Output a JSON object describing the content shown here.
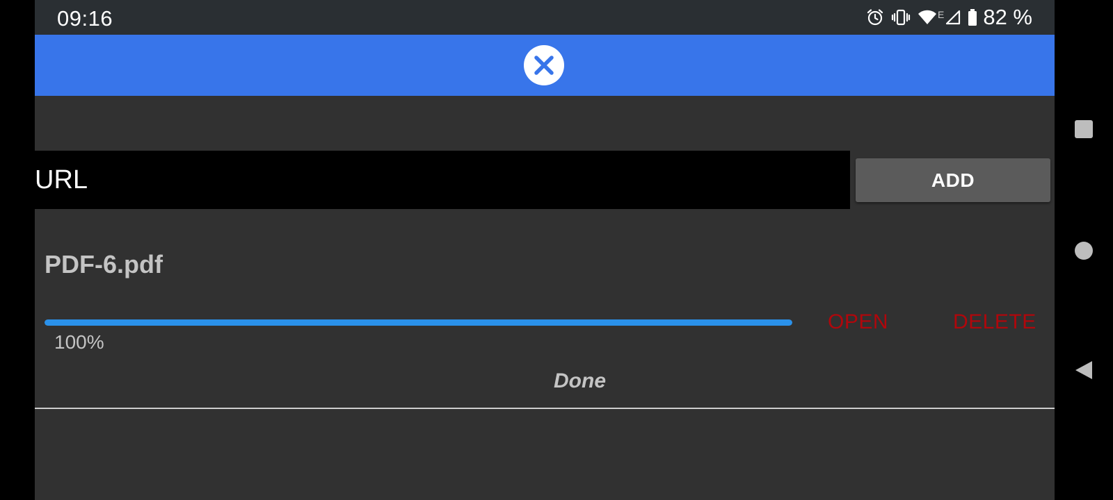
{
  "status_bar": {
    "time": "09:16",
    "battery_percent": "82 %",
    "network_type": "E",
    "icons": [
      "alarm-icon",
      "vibrate-icon",
      "wifi-icon",
      "signal-icon",
      "battery-icon"
    ]
  },
  "header": {
    "close_icon": "close-icon",
    "accent_color": "#3875ea"
  },
  "url_row": {
    "url_placeholder": "URL",
    "add_label": "ADD"
  },
  "downloads": [
    {
      "file_name": "PDF-6.pdf",
      "progress": 1.0,
      "progress_text": "100%",
      "open_label": "OPEN",
      "delete_label": "DELETE",
      "status": "Done",
      "progress_color": "#2a91ea",
      "action_color": "#b0070c"
    }
  ],
  "nav_bar": {
    "icons": [
      "recents-icon",
      "home-icon",
      "back-icon"
    ]
  }
}
